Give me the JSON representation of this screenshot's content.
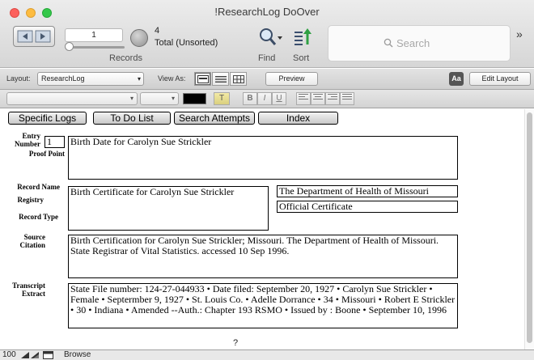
{
  "window": {
    "title": "!ResearchLog DoOver"
  },
  "toolbar": {
    "record_number": "1",
    "found_count": "4",
    "total_text": "Total (Unsorted)",
    "records_label": "Records",
    "find_label": "Find",
    "sort_label": "Sort",
    "search_placeholder": "Search",
    "overflow": "»"
  },
  "layoutbar": {
    "layout_label": "Layout:",
    "layout_value": "ResearchLog",
    "view_as_label": "View As:",
    "preview_label": "Preview",
    "aa_label": "Aa",
    "edit_layout_label": "Edit Layout"
  },
  "formatbar": {
    "highlight_label": "T",
    "bold": "B",
    "italic": "I",
    "underline": "U"
  },
  "tabs": [
    "Specific Logs",
    "To Do List",
    "Search Attempts",
    "Index"
  ],
  "form": {
    "entry_number_label": "Entry Number",
    "entry_number": "1",
    "proof_point_label": "Proof Point",
    "proof_point": "Birth Date for Carolyn Sue Strickler",
    "record_name_label": "Record Name",
    "registry_label": "Registry",
    "record_type_label": "Record Type",
    "record_name": "Birth Certificate for Carolyn Sue Strickler",
    "registry": "The Department of Health of Missouri",
    "record_type": "Official Certificate",
    "source_citation_label": "Source Citation",
    "source_citation": "Birth Certification for Carolyn Sue Strickler; Missouri. The Department of Health of Missouri. State Registrar of Vital Statistics. accessed 10 Sep 1996.",
    "transcript_label": "Transcript Extract",
    "transcript": "State File number: 124-27-044933 • Date filed: September 20, 1927 • Carolyn Sue Strickler • Female • Septermber 9, 1927 • St. Louis Co. • Adelle Dorrance • 34 • Missouri • Robert E Strickler • 30 • Indiana • Amended --Auth.: Chapter 193 RSMO • Issued by : Boone • September 10, 1996",
    "question_mark": "?"
  },
  "statusbar": {
    "zoom": "100",
    "mode": "Browse"
  }
}
